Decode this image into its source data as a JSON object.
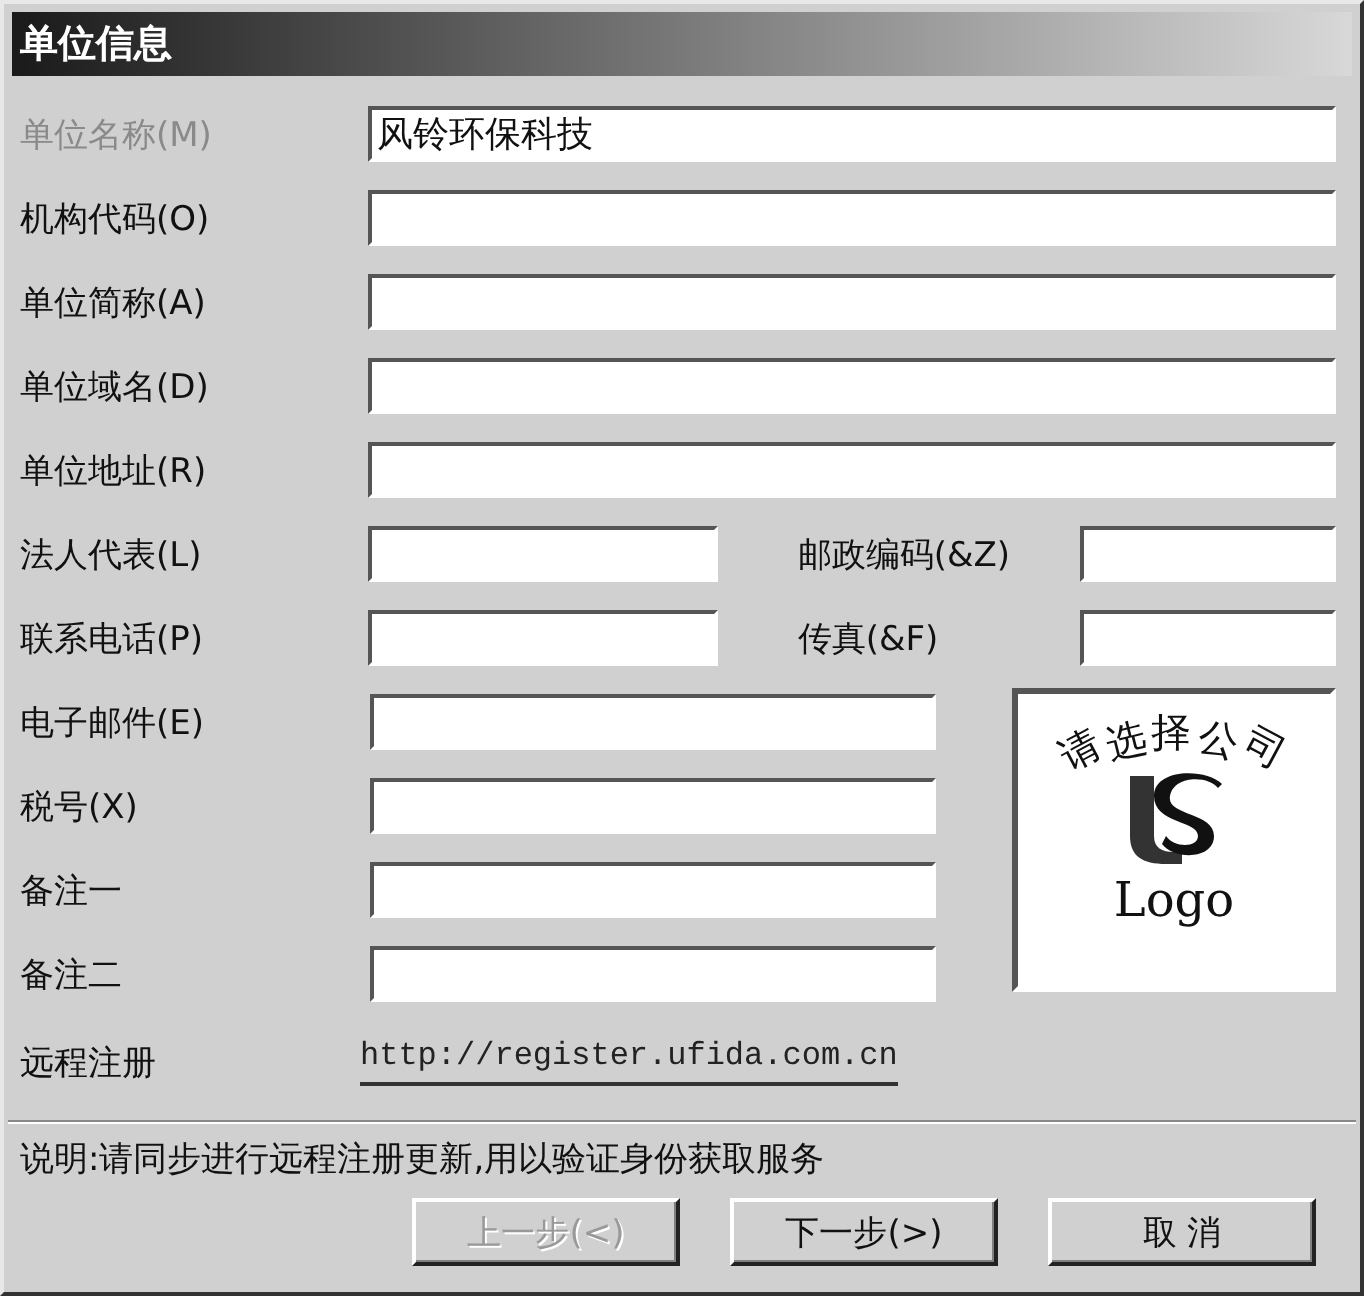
{
  "window": {
    "title": "单位信息"
  },
  "rows": [
    {
      "kind": "wide",
      "fields": [
        {
          "label": "单位名称(M)",
          "value": "风铃环保科技",
          "disabled": true
        }
      ]
    },
    {
      "kind": "wide",
      "fields": [
        {
          "label": "机构代码(O)",
          "disabled": false
        }
      ]
    },
    {
      "kind": "wide",
      "fields": [
        {
          "label": "单位简称(A)",
          "disabled": false
        }
      ]
    },
    {
      "kind": "wide",
      "fields": [
        {
          "label": "单位域名(D)",
          "disabled": false
        }
      ]
    },
    {
      "kind": "wide",
      "fields": [
        {
          "label": "单位地址(R)",
          "disabled": false
        }
      ]
    },
    {
      "kind": "pair",
      "fields": [
        {
          "label": "法人代表(L)",
          "disabled": false
        },
        {
          "label": "邮政编码(&Z)",
          "disabled": false
        }
      ]
    },
    {
      "kind": "pair",
      "fields": [
        {
          "label": "联系电话(P)",
          "disabled": false
        },
        {
          "label": "传真(&F)",
          "disabled": false
        }
      ]
    },
    {
      "kind": "medium",
      "fields": [
        {
          "label": "电子邮件(E)",
          "disabled": false
        }
      ]
    },
    {
      "kind": "medium",
      "fields": [
        {
          "label": "税号(X)",
          "disabled": false
        }
      ]
    },
    {
      "kind": "medium",
      "fields": [
        {
          "label": "备注一",
          "disabled": false
        }
      ]
    },
    {
      "kind": "medium",
      "fields": [
        {
          "label": "备注二",
          "disabled": false
        }
      ]
    }
  ],
  "logo": {
    "caption": "请选择公司",
    "text": "Logo"
  },
  "remote": {
    "label": "远程注册",
    "link": "http://register.ufida.com.cn"
  },
  "note": "说明:请同步进行远程注册更新,用以验证身份获取服务",
  "buttons": [
    {
      "label": "上一步(<)",
      "disabled": true
    },
    {
      "label": "下一步(>)",
      "disabled": false
    },
    {
      "label": "取 消",
      "disabled": false
    }
  ]
}
